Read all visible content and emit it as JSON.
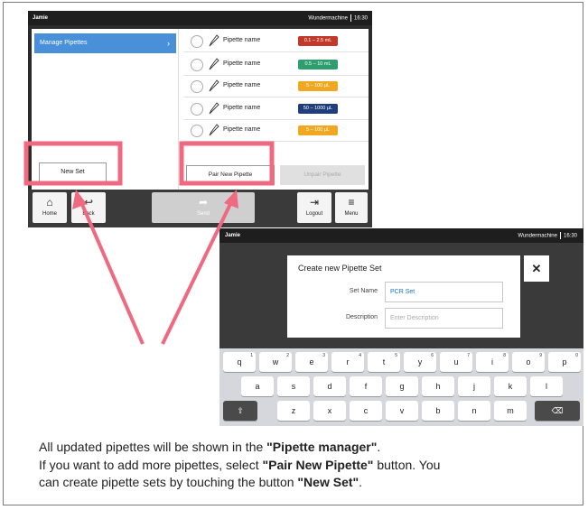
{
  "screen1": {
    "user": "Jamie",
    "device": "Wundermachine",
    "time": "16:30",
    "manage_label": "Manage Pipettes",
    "chevron_glyph": "›",
    "new_set_label": "New Set",
    "pair_label": "Pair New Pipette",
    "unpair_label": "Unpair Pipette",
    "pipettes": [
      {
        "name": "Pipette name",
        "range": "0.1 – 2.5 mL",
        "color": "#c0392b",
        "icon": "pipette-icon"
      },
      {
        "name": "Pipette name",
        "range": "0.5 – 10 mL",
        "color": "#2e9e6e",
        "icon": "pipette-icon"
      },
      {
        "name": "Pipette name",
        "range": "5 – 100 µL",
        "color": "#f0a820",
        "icon": "pipette-icon"
      },
      {
        "name": "Pipette name",
        "range": "50 – 1000 µL",
        "color": "#1f3e7a",
        "icon": "multichannel-pipette-icon"
      },
      {
        "name": "Pipette name",
        "range": "5 – 100 µL",
        "color": "#f0a820",
        "icon": "pipette-icon"
      }
    ],
    "footer": {
      "home": {
        "label": "Home",
        "icon": "home-icon",
        "glyph": "⌂"
      },
      "back": {
        "label": "Back",
        "icon": "back-icon",
        "glyph": "↩"
      },
      "send": {
        "label": "Send",
        "icon": "send-icon",
        "glyph": "➦"
      },
      "logout": {
        "label": "Logout",
        "icon": "logout-icon",
        "glyph": "⇥"
      },
      "menu": {
        "label": "Menu",
        "icon": "menu-icon",
        "glyph": "≡"
      }
    }
  },
  "screen2": {
    "user": "Jamie",
    "device": "Wundermachine",
    "time": "16:30",
    "dialog_title": "Create new Pipette Set",
    "set_name_label": "Set Name",
    "set_name_value": "PCR Set",
    "description_label": "Description",
    "description_placeholder": "Enter Description",
    "close_glyph": "✕",
    "keyboard": {
      "row1": [
        {
          "k": "q",
          "n": "1"
        },
        {
          "k": "w",
          "n": "2"
        },
        {
          "k": "e",
          "n": "3"
        },
        {
          "k": "r",
          "n": "4"
        },
        {
          "k": "t",
          "n": "5"
        },
        {
          "k": "y",
          "n": "6"
        },
        {
          "k": "u",
          "n": "7"
        },
        {
          "k": "i",
          "n": "8"
        },
        {
          "k": "o",
          "n": "9"
        },
        {
          "k": "p",
          "n": "0"
        }
      ],
      "row2": [
        "a",
        "s",
        "d",
        "f",
        "g",
        "h",
        "j",
        "k",
        "l"
      ],
      "row3": [
        "z",
        "x",
        "c",
        "v",
        "b",
        "n",
        "m"
      ],
      "shift_glyph": "⇧",
      "backspace_glyph": "⌫"
    }
  },
  "caption": {
    "line1_pre": "All updated pipettes will be shown in the ",
    "line1_bold": "\"Pipette manager\"",
    "line1_post": ".",
    "line2_pre": "If you want to add more pipettes, select ",
    "line2_bold": "\"Pair New Pipette\"",
    "line2_post": " button. You",
    "line3_pre": "can create pipette sets by touching the button ",
    "line3_bold": "\"New Set\"",
    "line3_post": "."
  },
  "colors": {
    "highlight": "#ef6a80",
    "manage_bg": "#4a90d9"
  }
}
